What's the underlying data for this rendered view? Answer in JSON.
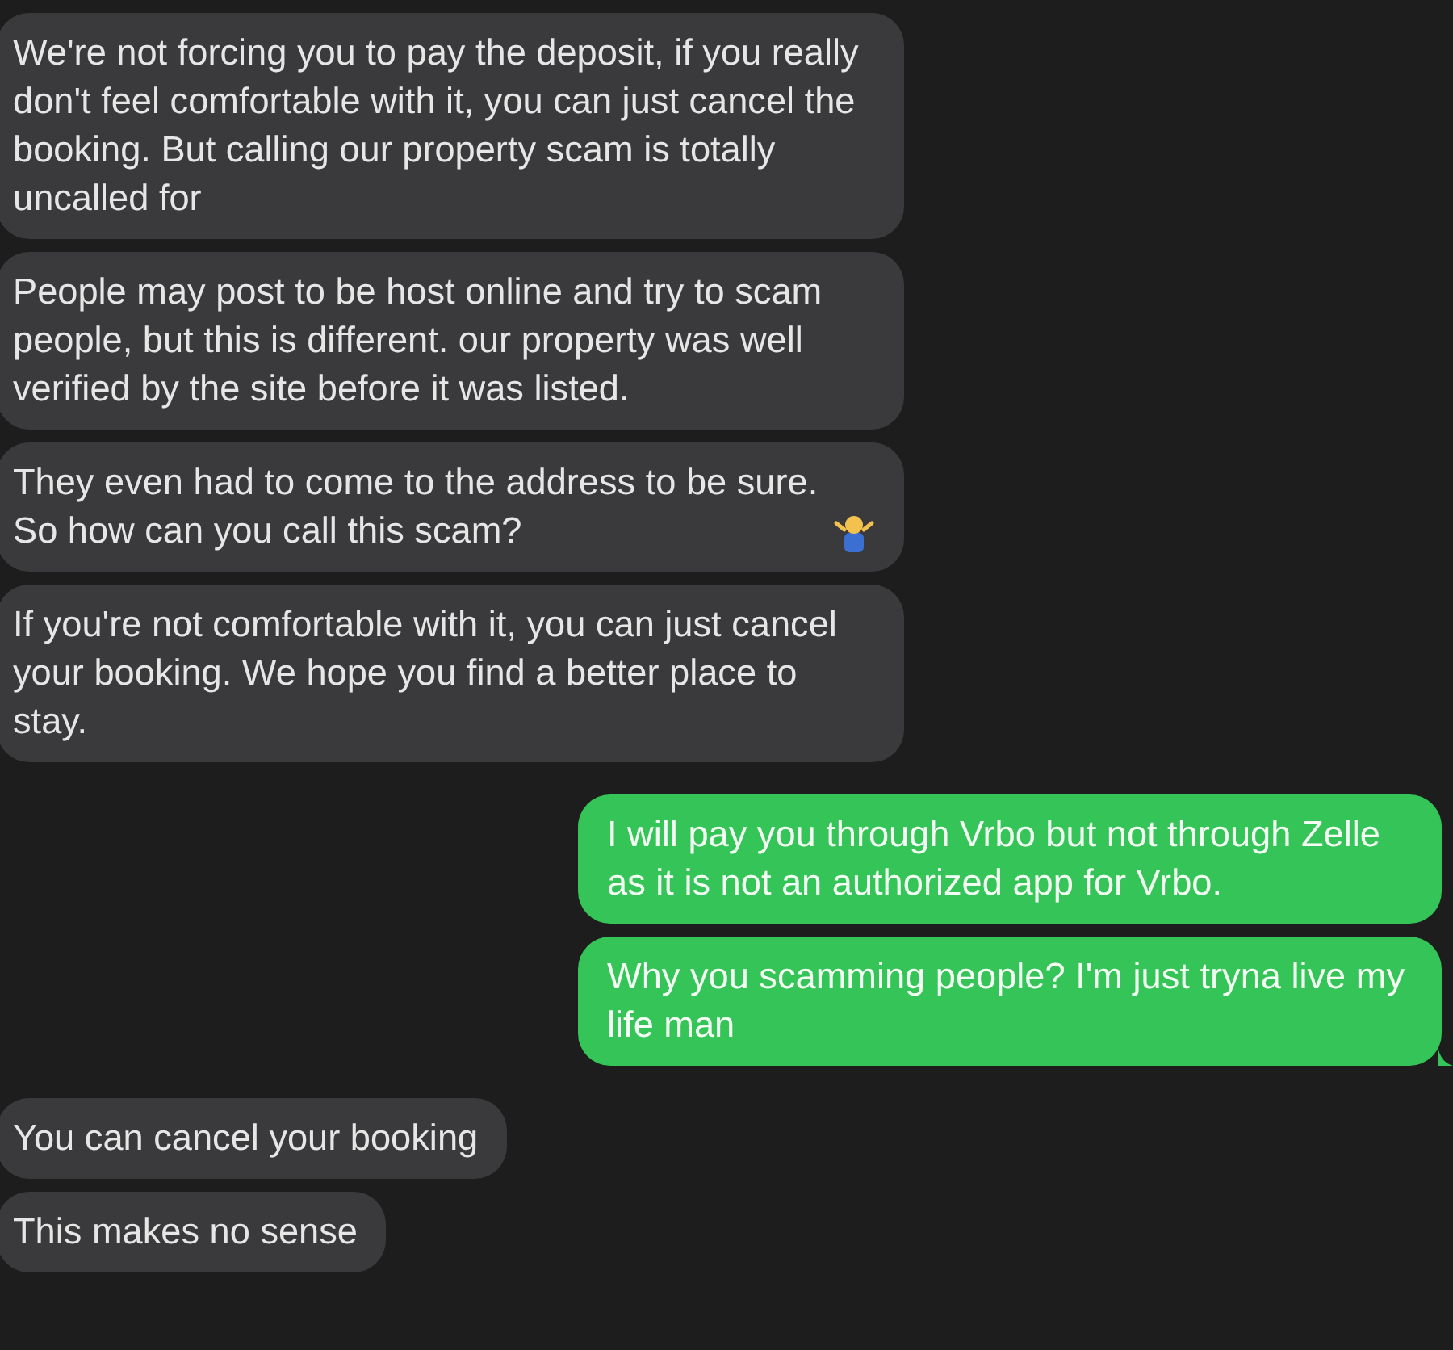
{
  "messages": [
    {
      "kind": "received",
      "text": "We're not forcing you to pay the deposit, if you really don't feel comfortable with it, you can just cancel the booking. But calling our property scam is totally uncalled for",
      "has_emoji": false,
      "tail": false
    },
    {
      "kind": "received",
      "text": "People may post to be host online and try to scam people, but this is different. our property was well verified by the site before it was listed.",
      "has_emoji": false,
      "tail": false
    },
    {
      "kind": "received",
      "text": "They even had to come to the address to be sure. So how can you call this scam?",
      "has_emoji": true,
      "tail": false
    },
    {
      "kind": "received",
      "text": "If you're not comfortable with it, you can just cancel your booking. We hope you find a better place to stay.",
      "has_emoji": false,
      "tail": false
    },
    {
      "kind": "sent",
      "text": "I will pay you through Vrbo but not through Zelle as it is not an authorized app for Vrbo.",
      "has_emoji": false,
      "tail": false
    },
    {
      "kind": "sent",
      "text": "Why you scamming people? I'm just tryna live my life man",
      "has_emoji": false,
      "tail": true
    },
    {
      "kind": "received",
      "text": "You can cancel your booking",
      "has_emoji": false,
      "tail": false
    },
    {
      "kind": "received",
      "text": "This makes no sense",
      "has_emoji": false,
      "tail": false
    }
  ]
}
